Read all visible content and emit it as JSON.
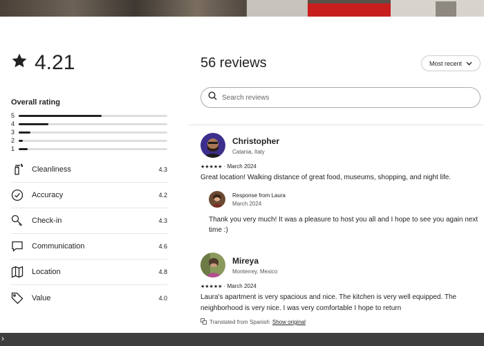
{
  "rating": {
    "star_icon": "star-icon",
    "value": "4.21"
  },
  "overall": {
    "title": "Overall rating",
    "distribution": [
      {
        "label": "5",
        "fraction": 0.56
      },
      {
        "label": "4",
        "fraction": 0.2
      },
      {
        "label": "3",
        "fraction": 0.08
      },
      {
        "label": "2",
        "fraction": 0.03
      },
      {
        "label": "1",
        "fraction": 0.06
      }
    ]
  },
  "categories": [
    {
      "name": "Cleanliness",
      "score": "4.3",
      "icon": "spray-bottle-icon"
    },
    {
      "name": "Accuracy",
      "score": "4.2",
      "icon": "check-circle-icon"
    },
    {
      "name": "Check-in",
      "score": "4.3",
      "icon": "key-icon"
    },
    {
      "name": "Communication",
      "score": "4.6",
      "icon": "message-icon"
    },
    {
      "name": "Location",
      "score": "4.8",
      "icon": "map-icon"
    },
    {
      "name": "Value",
      "score": "4.0",
      "icon": "tag-icon"
    }
  ],
  "reviews_header": {
    "count_label": "56 reviews",
    "sort_label": "Most recent"
  },
  "search": {
    "placeholder": "Search reviews",
    "value": ""
  },
  "reviews": [
    {
      "name": "Christopher",
      "location": "Catania, Italy",
      "stars": "★★★★★",
      "date": "· March 2024",
      "text": "Great location! Walking distance of great food, museums, shopping, and night life.",
      "response": {
        "title": "Response from Laura",
        "date": "March 2024",
        "text": "Thank you very much! It was a pleasure to host you all and I hope to see you again next time :)"
      }
    },
    {
      "name": "Mireya",
      "location": "Monterrey, Mexico",
      "stars": "★★★★★",
      "date": "· March 2024",
      "text": "Laura's apartment is very spacious and nice. The kitchen is very well equipped. The neighborhood is very nice. I was very comfortable I hope to return",
      "translated": "Translated from Spanish",
      "show_original": "Show original"
    }
  ],
  "colors": {
    "text": "#222222",
    "divider": "#e5e5e5",
    "bar_fill": "#222222",
    "bar_track": "#dddddd"
  }
}
